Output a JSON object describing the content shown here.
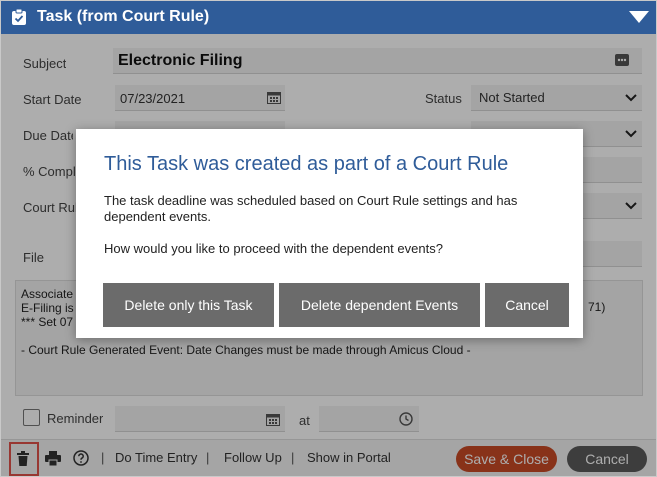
{
  "window": {
    "title": "Task (from Court Rule)"
  },
  "form": {
    "subject_label": "Subject",
    "subject_value": "Electronic Filing",
    "start_date_label": "Start Date",
    "start_date_value": "07/23/2021",
    "status_label": "Status",
    "status_value": "Not Started",
    "due_date_label": "Due Date",
    "due_date_value": "",
    "percent_label": "% Complete",
    "court_rule_label": "Court Rule",
    "file_label": "File",
    "notes_line1": "Associate",
    "notes_line1_suffix": "71)",
    "notes_line2": "E-Filing is",
    "notes_line3": "*** Set 07",
    "notes_line4": "- Court Rule Generated Event: Date Changes must be made through Amicus Cloud -",
    "reminder_label": "Reminder",
    "at_label": "at"
  },
  "footer": {
    "sep": "|",
    "do_time_entry": "Do Time Entry",
    "follow_up": "Follow Up",
    "show_in_portal": "Show in Portal",
    "save_close": "Save & Close",
    "cancel": "Cancel"
  },
  "modal": {
    "title": "This Task was created as part of a Court Rule",
    "body1": "The task deadline was scheduled based on Court Rule settings and has dependent events.",
    "body2": "How would you like to proceed with the dependent events?",
    "btn_delete_task": "Delete only this Task",
    "btn_delete_events": "Delete dependent Events",
    "btn_cancel": "Cancel"
  },
  "colors": {
    "header": "#2f5c99",
    "save_button": "#c94a26",
    "modal_button": "#6b6b6b",
    "highlight": "#e0514a"
  }
}
